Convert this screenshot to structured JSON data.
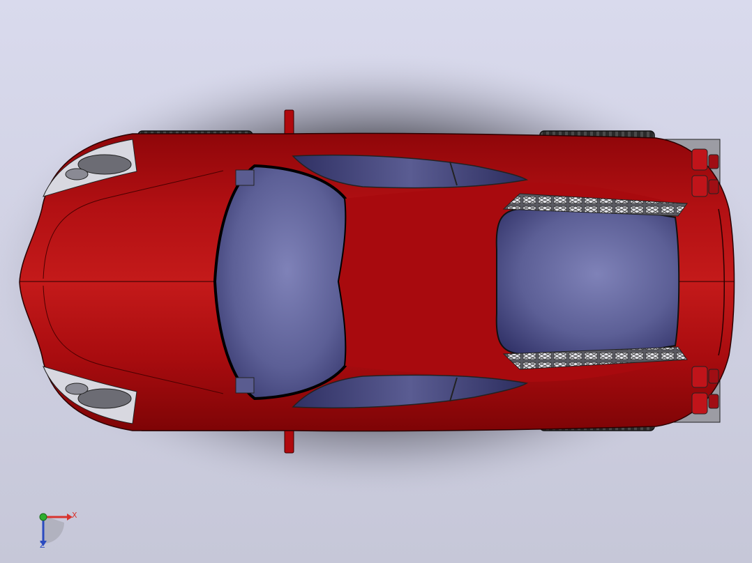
{
  "colors": {
    "background_top": "#d8d9ec",
    "background_bottom": "#c7c8d9",
    "body_paint": "#a5080c",
    "body_paint_light": "#c11717",
    "glass": "#6f72a8",
    "glass_dark": "#3e3f70",
    "tire": "#2b2b2b",
    "axis_x": "#d8332e",
    "axis_y": "#2fae2f",
    "axis_z": "#2b4bc0"
  },
  "view": {
    "orientation": "top",
    "model": "car"
  },
  "triad": {
    "x_label": "X",
    "z_label": "Z"
  }
}
